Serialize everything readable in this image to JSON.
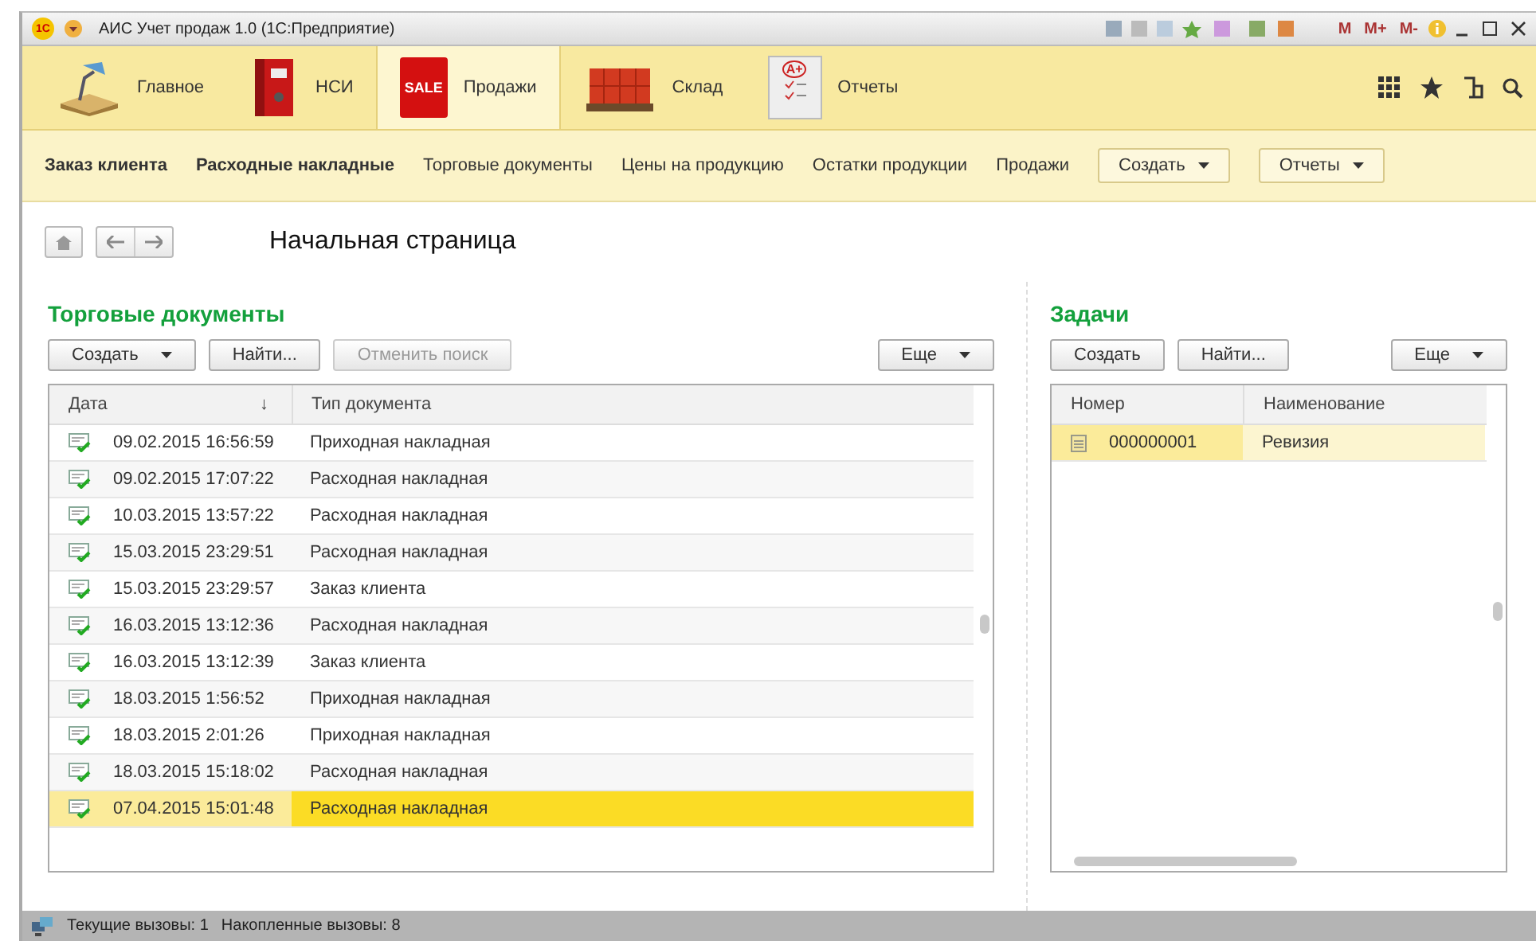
{
  "window": {
    "title": "АИС Учет продаж 1.0  (1С:Предприятие)",
    "logo": "1С",
    "memory_buttons": [
      "M",
      "M+",
      "M-"
    ]
  },
  "sections": [
    {
      "label": "Главное",
      "selected": false
    },
    {
      "label": "НСИ",
      "selected": false
    },
    {
      "label": "Продажи",
      "selected": true,
      "badge": "SALE"
    },
    {
      "label": "Склад",
      "selected": false
    },
    {
      "label": "Отчеты",
      "selected": false,
      "badge": "A+"
    }
  ],
  "commands": [
    {
      "label": "Заказ клиента",
      "kind": "important"
    },
    {
      "label": "Расходные накладные",
      "kind": "important"
    },
    {
      "label": "Торговые документы",
      "kind": "link"
    },
    {
      "label": "Цены на продукцию",
      "kind": "link"
    },
    {
      "label": "Остатки продукции",
      "kind": "link"
    },
    {
      "label": "Продажи",
      "kind": "link"
    },
    {
      "label": "Создать",
      "kind": "menu"
    },
    {
      "label": "Отчеты",
      "kind": "menu"
    }
  ],
  "page_title": "Начальная страница",
  "documents": {
    "title": "Торговые документы",
    "buttons": [
      {
        "label": "Создать",
        "dropdown": true,
        "disabled": false
      },
      {
        "label": "Найти...",
        "dropdown": false,
        "disabled": false
      },
      {
        "label": "Отменить поиск",
        "dropdown": false,
        "disabled": true
      }
    ],
    "more_button": "Еще",
    "columns": [
      "Дата",
      "Тип документа"
    ],
    "sort_mark": "↓",
    "rows": [
      {
        "date": "09.02.2015 16:56:59",
        "type": "Приходная накладная",
        "selected": false
      },
      {
        "date": "09.02.2015 17:07:22",
        "type": "Расходная накладная",
        "selected": false
      },
      {
        "date": "10.03.2015 13:57:22",
        "type": "Расходная накладная",
        "selected": false
      },
      {
        "date": "15.03.2015 23:29:51",
        "type": "Расходная накладная",
        "selected": false
      },
      {
        "date": "15.03.2015 23:29:57",
        "type": "Заказ клиента",
        "selected": false
      },
      {
        "date": "16.03.2015 13:12:36",
        "type": "Расходная накладная",
        "selected": false
      },
      {
        "date": "16.03.2015 13:12:39",
        "type": "Заказ клиента",
        "selected": false
      },
      {
        "date": "18.03.2015 1:56:52",
        "type": "Приходная накладная",
        "selected": false
      },
      {
        "date": "18.03.2015 2:01:26",
        "type": "Приходная накладная",
        "selected": false
      },
      {
        "date": "18.03.2015 15:18:02",
        "type": "Расходная накладная",
        "selected": false
      },
      {
        "date": "07.04.2015 15:01:48",
        "type": "Расходная накладная",
        "selected": true
      }
    ]
  },
  "tasks": {
    "title": "Задачи",
    "buttons": [
      {
        "label": "Создать",
        "dropdown": false,
        "disabled": false
      },
      {
        "label": "Найти...",
        "dropdown": false,
        "disabled": false
      }
    ],
    "more_button": "Еще",
    "columns": [
      "Номер",
      "Наименование"
    ],
    "rows": [
      {
        "number": "000000001",
        "name": "Ревизия",
        "selected": true
      }
    ]
  },
  "status_bar": {
    "current_calls": "Текущие вызовы: 1",
    "total_calls": "Накопленные вызовы: 8"
  }
}
